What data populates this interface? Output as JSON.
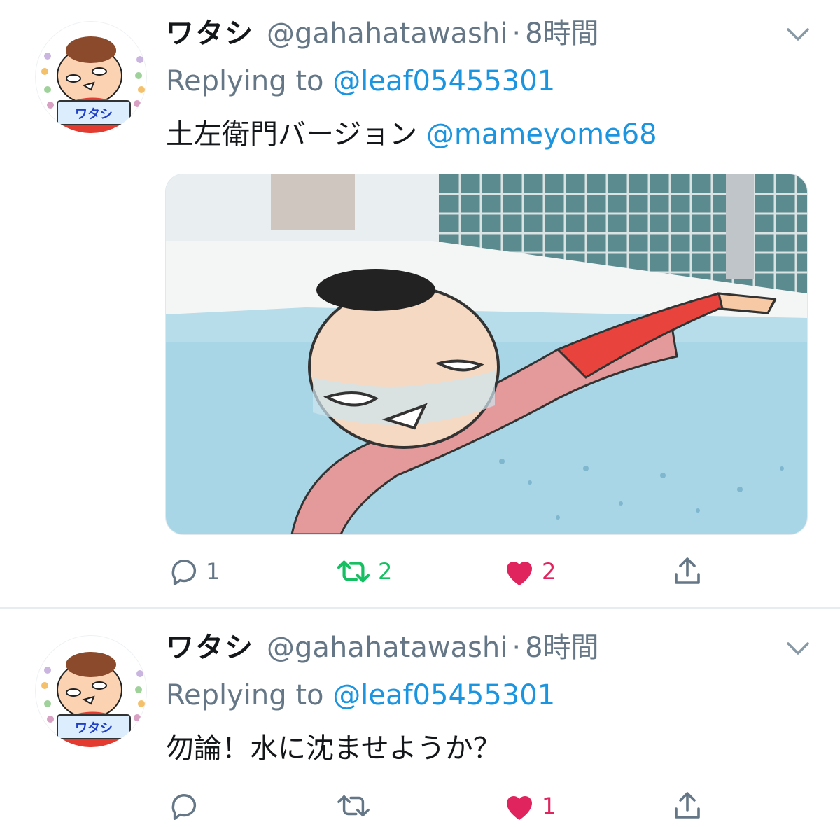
{
  "tweets": [
    {
      "display_name": "ワタシ",
      "handle": "@gahahatawashi",
      "separator": "·",
      "time": "8時間",
      "replying_prefix": "Replying to",
      "replying_to": "@leaf05455301",
      "text": "土左衛門バージョン",
      "mention": "@mameyome68",
      "avatar_text": "ワタシ",
      "actions": {
        "reply_count": "1",
        "retweet_count": "2",
        "like_count": "2"
      }
    },
    {
      "display_name": "ワタシ",
      "handle": "@gahahatawashi",
      "separator": "·",
      "time": "8時間",
      "replying_prefix": "Replying to",
      "replying_to": "@leaf05455301",
      "text": "勿論！水に沈ませようか？",
      "avatar_text": "ワタシ",
      "actions": {
        "reply_count": "",
        "retweet_count": "",
        "like_count": "1"
      }
    }
  ],
  "icons": [
    "chevron-down-icon",
    "reply-icon",
    "retweet-icon",
    "heart-icon",
    "share-icon"
  ],
  "colors": {
    "link": "#1b95e0",
    "secondary_text": "#657786",
    "primary_text": "#14171a",
    "retweet_active": "#17bf63",
    "like_active": "#e0245e",
    "divider": "#e6ecf0"
  }
}
